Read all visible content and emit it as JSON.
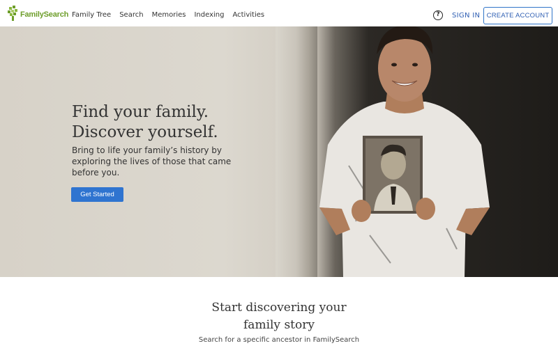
{
  "header": {
    "logo_text": "FamilySearch",
    "nav": [
      "Family Tree",
      "Search",
      "Memories",
      "Indexing",
      "Activities"
    ],
    "help_label": "?",
    "sign_in": "SIGN IN",
    "create_account": "CREATE ACCOUNT"
  },
  "hero": {
    "title_line1": "Find your family.",
    "title_line2": "Discover yourself.",
    "subtitle": "Bring to life your family’s history by exploring the lives of those that came before you.",
    "cta": "Get Started"
  },
  "story": {
    "title_line1": "Start discovering your",
    "title_line2": "family story",
    "subtitle": "Search for a specific ancestor in FamilySearch"
  },
  "colors": {
    "brand_green": "#6e9e2b",
    "link_blue": "#2f5fb3",
    "button_blue": "#2f74d0"
  }
}
